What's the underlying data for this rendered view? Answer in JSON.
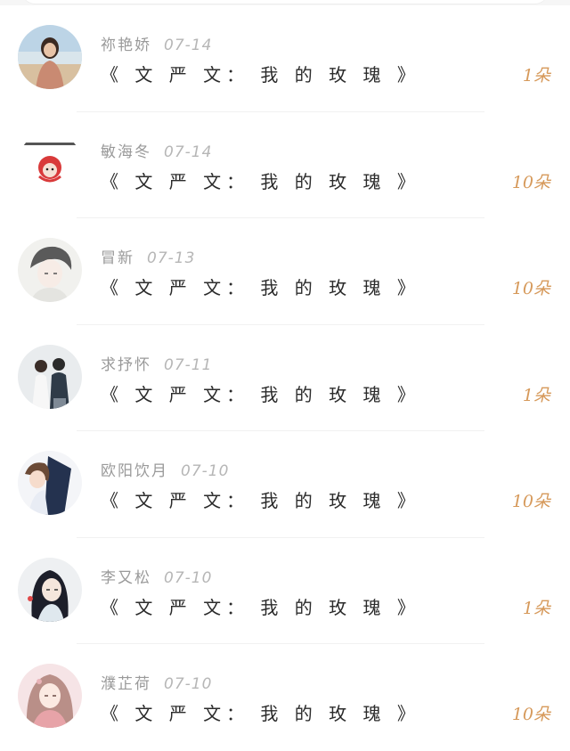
{
  "accent_color": "#d6995a",
  "items": [
    {
      "name": "祢艳娇",
      "date": "07-14",
      "title": "《 文 严 文： 我 的 玫 瑰 》",
      "count": "1朵",
      "avatar_icon": "photo-avatar-beach"
    },
    {
      "name": "敏海冬",
      "date": "07-14",
      "title": "《 文 严 文： 我 的 玫 瑰 》",
      "count": "10朵",
      "avatar_icon": "cartoon-avatar"
    },
    {
      "name": "冒新",
      "date": "07-13",
      "title": "《 文 严 文： 我 的 玫 瑰 》",
      "count": "10朵",
      "avatar_icon": "sketch-avatar"
    },
    {
      "name": "求抒怀",
      "date": "07-11",
      "title": "《 文 严 文： 我 的 玫 瑰 》",
      "count": "1朵",
      "avatar_icon": "photo-avatar-couple"
    },
    {
      "name": "欧阳饮月",
      "date": "07-10",
      "title": "《 文 严 文： 我 的 玫 瑰 》",
      "count": "10朵",
      "avatar_icon": "anime-avatar"
    },
    {
      "name": "李又松",
      "date": "07-10",
      "title": "《 文 严 文： 我 的 玫 瑰 》",
      "count": "1朵",
      "avatar_icon": "anime-avatar-longhair"
    },
    {
      "name": "濮芷荷",
      "date": "07-10",
      "title": "《 文 严 文： 我 的 玫 瑰 》",
      "count": "10朵",
      "avatar_icon": "anime-avatar-pink"
    }
  ]
}
